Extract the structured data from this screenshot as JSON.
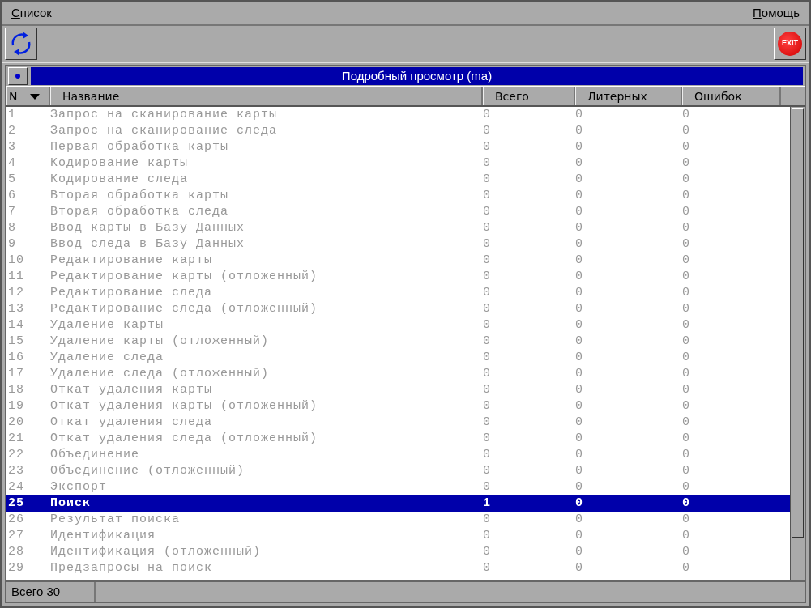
{
  "menu": [
    {
      "label": "Список"
    },
    {
      "label": "Помощь"
    }
  ],
  "toolbar": {
    "exit_label": "EXIT"
  },
  "panel": {
    "title": "Подробный просмотр (ma)"
  },
  "table": {
    "columns": [
      {
        "label": "N",
        "sorted": true
      },
      {
        "label": "Название",
        "sorted": false
      },
      {
        "label": "Всего",
        "sorted": false
      },
      {
        "label": "Литерных",
        "sorted": false
      },
      {
        "label": "Ошибок",
        "sorted": false
      }
    ],
    "rows": [
      {
        "cells": [
          "1",
          "Запрос на сканирование карты",
          "0",
          "0",
          "0"
        ],
        "selected": false
      },
      {
        "cells": [
          "2",
          "Запрос на сканирование следа",
          "0",
          "0",
          "0"
        ],
        "selected": false
      },
      {
        "cells": [
          "3",
          "Первая обработка карты",
          "0",
          "0",
          "0"
        ],
        "selected": false
      },
      {
        "cells": [
          "4",
          "Кодирование карты",
          "0",
          "0",
          "0"
        ],
        "selected": false
      },
      {
        "cells": [
          "5",
          "Кодирование следа",
          "0",
          "0",
          "0"
        ],
        "selected": false
      },
      {
        "cells": [
          "6",
          "Вторая обработка карты",
          "0",
          "0",
          "0"
        ],
        "selected": false
      },
      {
        "cells": [
          "7",
          "Вторая обработка следа",
          "0",
          "0",
          "0"
        ],
        "selected": false
      },
      {
        "cells": [
          "8",
          "Ввод карты в Базу Данных",
          "0",
          "0",
          "0"
        ],
        "selected": false
      },
      {
        "cells": [
          "9",
          "Ввод следа в Базу Данных",
          "0",
          "0",
          "0"
        ],
        "selected": false
      },
      {
        "cells": [
          "10",
          "Редактирование карты",
          "0",
          "0",
          "0"
        ],
        "selected": false
      },
      {
        "cells": [
          "11",
          "Редактирование карты (отложенный)",
          "0",
          "0",
          "0"
        ],
        "selected": false
      },
      {
        "cells": [
          "12",
          "Редактирование следа",
          "0",
          "0",
          "0"
        ],
        "selected": false
      },
      {
        "cells": [
          "13",
          "Редактирование следа (отложенный)",
          "0",
          "0",
          "0"
        ],
        "selected": false
      },
      {
        "cells": [
          "14",
          "Удаление карты",
          "0",
          "0",
          "0"
        ],
        "selected": false
      },
      {
        "cells": [
          "15",
          "Удаление карты (отложенный)",
          "0",
          "0",
          "0"
        ],
        "selected": false
      },
      {
        "cells": [
          "16",
          "Удаление следа",
          "0",
          "0",
          "0"
        ],
        "selected": false
      },
      {
        "cells": [
          "17",
          "Удаление следа (отложенный)",
          "0",
          "0",
          "0"
        ],
        "selected": false
      },
      {
        "cells": [
          "18",
          "Откат удаления карты",
          "0",
          "0",
          "0"
        ],
        "selected": false
      },
      {
        "cells": [
          "19",
          "Откат удаления карты (отложенный)",
          "0",
          "0",
          "0"
        ],
        "selected": false
      },
      {
        "cells": [
          "20",
          "Откат удаления следа",
          "0",
          "0",
          "0"
        ],
        "selected": false
      },
      {
        "cells": [
          "21",
          "Откат удаления следа (отложенный)",
          "0",
          "0",
          "0"
        ],
        "selected": false
      },
      {
        "cells": [
          "22",
          "Объединение",
          "0",
          "0",
          "0"
        ],
        "selected": false
      },
      {
        "cells": [
          "23",
          "Объединение (отложенный)",
          "0",
          "0",
          "0"
        ],
        "selected": false
      },
      {
        "cells": [
          "24",
          "Экспорт",
          "0",
          "0",
          "0"
        ],
        "selected": false
      },
      {
        "cells": [
          "25",
          "Поиск",
          "1",
          "0",
          "0"
        ],
        "selected": true
      },
      {
        "cells": [
          "26",
          "Результат поиска",
          "0",
          "0",
          "0"
        ],
        "selected": false
      },
      {
        "cells": [
          "27",
          "Идентификация",
          "0",
          "0",
          "0"
        ],
        "selected": false
      },
      {
        "cells": [
          "28",
          "Идентификация (отложенный)",
          "0",
          "0",
          "0"
        ],
        "selected": false
      },
      {
        "cells": [
          "29",
          "Предзапросы на поиск",
          "0",
          "0",
          "0"
        ],
        "selected": false
      }
    ]
  },
  "status_bar": {
    "text": "Всего 30"
  }
}
